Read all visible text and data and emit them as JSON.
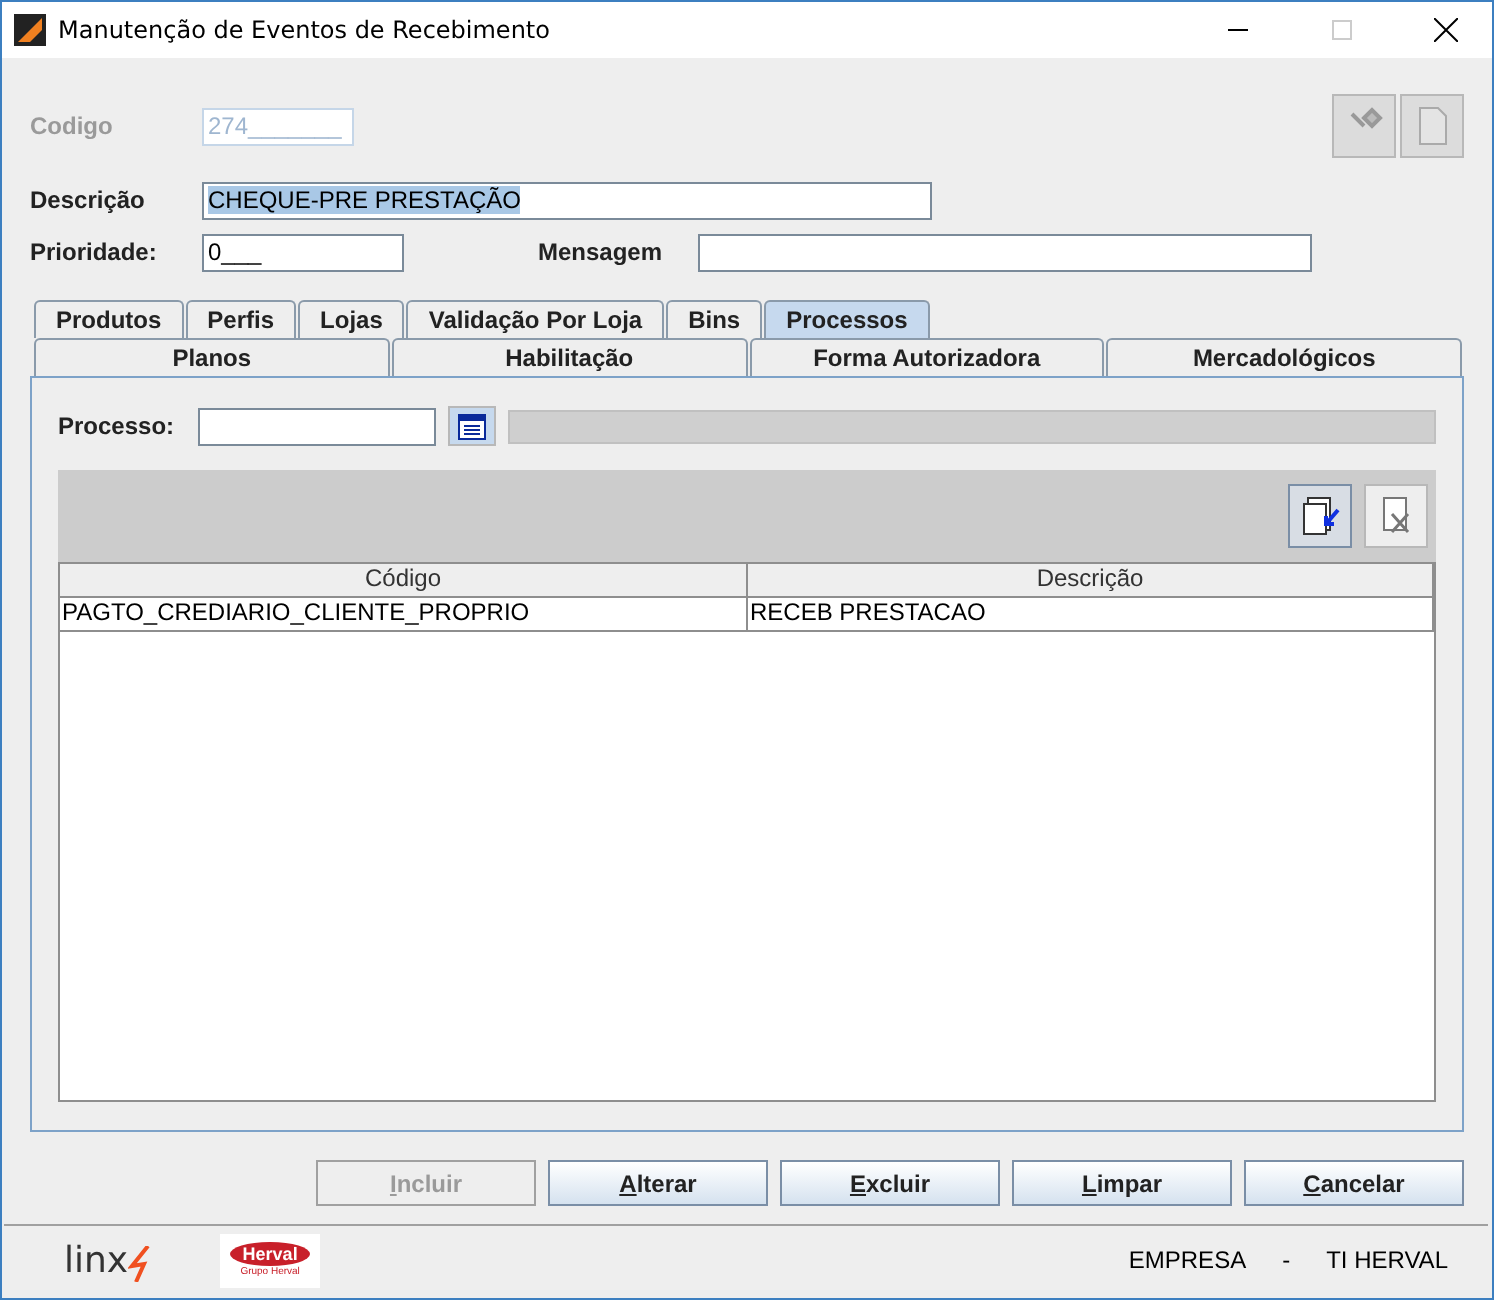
{
  "window": {
    "title": "Manutenção de Eventos de Recebimento"
  },
  "form": {
    "codigo": {
      "label": "Codigo",
      "value": "274_______",
      "disabled": true
    },
    "descricao": {
      "label": "Descrição",
      "value": "CHEQUE-PRE PRESTAÇÃO"
    },
    "prioridade": {
      "label": "Prioridade:",
      "value": "0___"
    },
    "mensagem": {
      "label": "Mensagem"
    }
  },
  "tabs_top": [
    {
      "label": "Produtos",
      "selected": false
    },
    {
      "label": "Perfis",
      "selected": false
    },
    {
      "label": "Lojas",
      "selected": false
    },
    {
      "label": "Validação Por Loja",
      "selected": false
    },
    {
      "label": "Bins",
      "selected": false
    },
    {
      "label": "Processos",
      "selected": true
    }
  ],
  "tabs_bottom": [
    {
      "label": "Planos",
      "selected": false
    },
    {
      "label": "Habilitação",
      "selected": false
    },
    {
      "label": "Forma Autorizadora",
      "selected": false
    },
    {
      "label": "Mercadológicos",
      "selected": false
    }
  ],
  "processo": {
    "label": "Processo:",
    "description_disabled": true
  },
  "table": {
    "columns": [
      "Código",
      "Descrição"
    ],
    "rows": [
      [
        "PAGTO_CREDIARIO_CLIENTE_PROPRIO",
        "RECEB PRESTACAO"
      ]
    ]
  },
  "buttons": [
    {
      "label": "Incluir",
      "disabled": true
    },
    {
      "label": "Alterar",
      "disabled": false
    },
    {
      "label": "Excluir",
      "disabled": false
    },
    {
      "label": "Limpar",
      "disabled": false
    },
    {
      "label": "Cancelar",
      "disabled": false
    }
  ],
  "footer": {
    "logo_1": "linx",
    "logo_2": "Herval",
    "logo_2_sub": "Grupo Herval",
    "empresa_label": "EMPRESA",
    "separator": "-",
    "empresa": "TI HERVAL"
  }
}
